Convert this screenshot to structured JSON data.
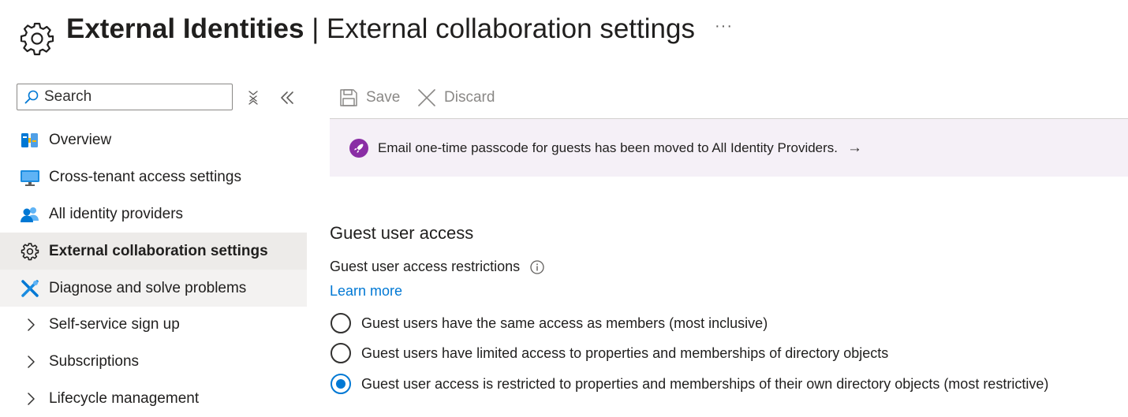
{
  "header": {
    "title_bold": "External Identities",
    "title_rest": " | External collaboration settings",
    "more_label": "···",
    "icon": "gear-icon"
  },
  "sidebar": {
    "search_placeholder": "Search",
    "clear_icon": "clear-filter-icon",
    "collapse_icon": "double-chevron-left-icon",
    "items": [
      {
        "label": "Overview",
        "icon": "overview-icon"
      },
      {
        "label": "Cross-tenant access settings",
        "icon": "monitor-icon"
      },
      {
        "label": "All identity providers",
        "icon": "people-icon"
      },
      {
        "label": "External collaboration settings",
        "icon": "gear-icon",
        "active": true
      },
      {
        "label": "Diagnose and solve problems",
        "icon": "wrench-icon"
      },
      {
        "label": "Self-service sign up",
        "icon": "chevron-right-icon"
      },
      {
        "label": "Subscriptions",
        "icon": "chevron-right-icon"
      },
      {
        "label": "Lifecycle management",
        "icon": "chevron-right-icon"
      }
    ]
  },
  "toolbar": {
    "save_label": "Save",
    "discard_label": "Discard"
  },
  "banner": {
    "message": "Email one-time passcode for guests has been moved to All Identity Providers.",
    "arrow": "→"
  },
  "guest_access": {
    "section_title": "Guest user access",
    "restrictions_label": "Guest user access restrictions",
    "learn_more": "Learn more",
    "options": [
      {
        "label": "Guest users have the same access as members (most inclusive)",
        "selected": false
      },
      {
        "label": "Guest users have limited access to properties and memberships of directory objects",
        "selected": false
      },
      {
        "label": "Guest user access is restricted to properties and memberships of their own directory objects (most restrictive)",
        "selected": true
      }
    ]
  },
  "colors": {
    "accent": "#0078d4",
    "banner_bg": "#f5f0f7",
    "rocket": "#8a2da5",
    "active_nav_bg": "#edebe9"
  }
}
